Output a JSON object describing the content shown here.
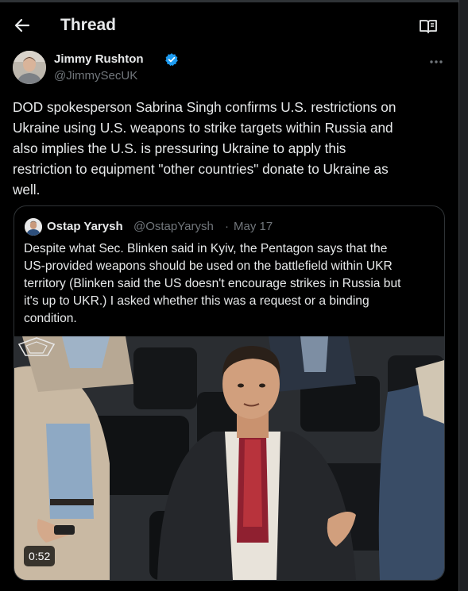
{
  "header": {
    "title": "Thread",
    "back_icon": "arrow-left-icon",
    "reader_icon": "book-open-icon"
  },
  "author": {
    "name": "Jimmy Rushton",
    "handle": "@JimmySecUK",
    "verified_color": "#1d9bf0",
    "more_icon": "more-horizontal-icon"
  },
  "tweet": {
    "lines": [
      "DOD spokesperson Sabrina Singh confirms U.S. restrictions on",
      "Ukraine using U.S. weapons to strike targets within Russia and",
      "also implies the U.S. is pressuring Ukraine to apply this",
      "restriction to equipment \"other countries\" donate to Ukraine as",
      "well."
    ]
  },
  "quote": {
    "name": "Ostap Yarysh",
    "handle": "@OstapYarysh",
    "separator": "·",
    "date": "May 17",
    "lines": [
      "Despite what Sec. Blinken said in Kyiv, the Pentagon says that the",
      "US-provided weapons should be used on the battlefield within UKR",
      "territory (Blinken said the US doesn't encourage strikes in Russia but",
      "it's up to UKR.) I asked whether this was a request or a binding",
      "condition."
    ],
    "video_duration": "0:52"
  },
  "colors": {
    "background": "#000000",
    "text": "#e7e9ea",
    "muted": "#71767b",
    "border": "#2f3336"
  }
}
